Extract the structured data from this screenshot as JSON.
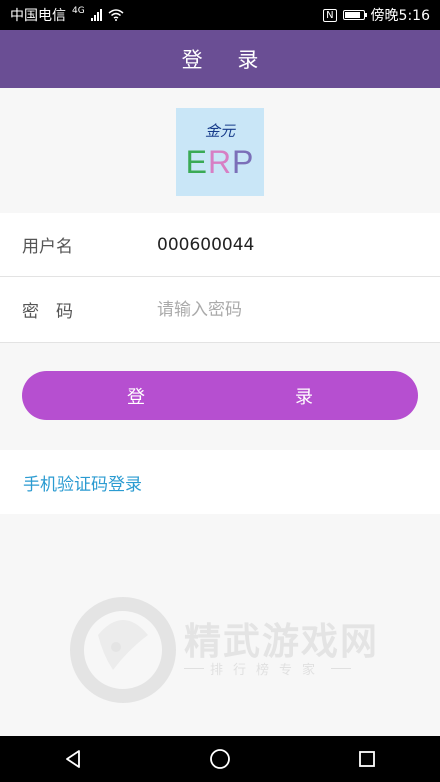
{
  "status_bar": {
    "carrier": "中国电信",
    "network_type": "4G",
    "nfc": "N",
    "time": "傍晚5:16",
    "battery_level": 0.85
  },
  "header": {
    "title": "登 录"
  },
  "logo": {
    "script_text": "金元",
    "erp_e": "E",
    "erp_r": "R",
    "erp_p": "P"
  },
  "form": {
    "username_label": "用户名",
    "username_value": "000600044",
    "password_label": "密　码",
    "password_placeholder": "请输入密码"
  },
  "login_button": {
    "label": "登　　录"
  },
  "sms_login": {
    "label": "手机验证码登录"
  },
  "watermark": {
    "title": "精武游戏网",
    "subtitle": "排行榜专家"
  },
  "colors": {
    "header_bg": "#6a4e94",
    "button_bg": "#b64fd0",
    "link": "#2b9bd1"
  },
  "nav_icons": [
    "back-icon",
    "home-icon",
    "recent-apps-icon"
  ]
}
